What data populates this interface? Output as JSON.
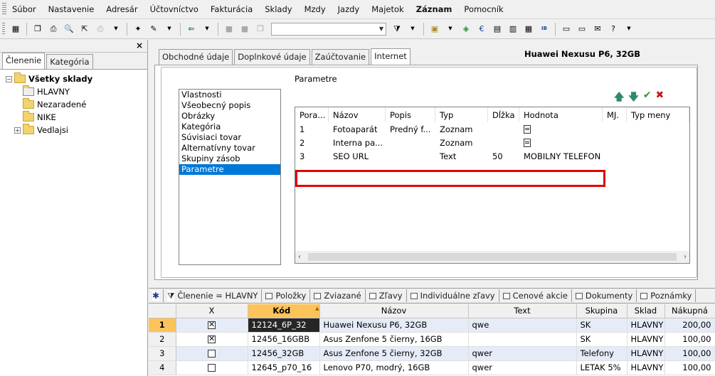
{
  "menubar": {
    "items": [
      "Súbor",
      "Nastavenie",
      "Adresár",
      "Účtovníctvo",
      "Fakturácia",
      "Sklady",
      "Mzdy",
      "Jazdy",
      "Majetok",
      "Záznam",
      "Pomocník"
    ]
  },
  "toolbar": {
    "combo_value": ""
  },
  "left_panel": {
    "tabs": [
      "Členenie",
      "Kategória"
    ],
    "tree": {
      "root": "Všetky sklady",
      "items": [
        "HLAVNY",
        "Nezaradené",
        "NIKE",
        "Vedlajsi"
      ]
    }
  },
  "detail": {
    "tabs": [
      "Obchodné údaje",
      "Doplnkové údaje",
      "Zaúčtovanie",
      "Internet"
    ],
    "product_title": "Huawei Nexusu P6, 32GB",
    "categories": [
      "Vlastnosti",
      "Všeobecný popis",
      "Obrázky",
      "Kategória",
      "Súvisiaci tovar",
      "Alternatívny tovar",
      "Skupiny zásob",
      "Parametre"
    ],
    "section_label": "Parametre",
    "grid": {
      "columns": [
        "Pora...",
        "Názov",
        "Popis",
        "Typ",
        "Dĺžka",
        "Hodnota",
        "MJ.",
        "Typ meny"
      ],
      "rows": [
        {
          "order": "1",
          "name": "Fotoaparát",
          "desc": "Predný f...",
          "type": "Zoznam",
          "length": "",
          "value": ""
        },
        {
          "order": "2",
          "name": "Interna pa...",
          "desc": "",
          "type": "Zoznam",
          "length": "",
          "value": ""
        },
        {
          "order": "3",
          "name": "SEO URL",
          "desc": "",
          "type": "Text",
          "length": "50",
          "value": "MOBILNY TELEFON"
        }
      ]
    }
  },
  "bottom_tabs": {
    "items": [
      "Členenie = HLAVNY",
      "Položky",
      "Zviazané",
      "Zľavy",
      "Individuálne zľavy",
      "Cenové akcie",
      "Dokumenty",
      "Poznámky"
    ]
  },
  "table": {
    "columns": [
      "",
      "X",
      "Kód",
      "Názov",
      "Text",
      "Skupina",
      "Sklad",
      "Nákupná"
    ],
    "rows": [
      {
        "num": "1",
        "checked": true,
        "kod": "12124_6P_32",
        "nazov": "Huawei Nexusu P6, 32GB",
        "text": "qwe",
        "skupina": "SK",
        "sklad": "HLAVNY",
        "nakupna": "200,00"
      },
      {
        "num": "2",
        "checked": true,
        "kod": "12456_16GBB",
        "nazov": "Asus Zenfone 5 čierny, 16GB",
        "text": "",
        "skupina": "SK",
        "sklad": "HLAVNY",
        "nakupna": "100,00"
      },
      {
        "num": "3",
        "checked": false,
        "kod": "12456_32GB",
        "nazov": "Asus Zenfone 5 čierny, 32GB",
        "text": "qwer",
        "skupina": "Telefony",
        "sklad": "HLAVNY",
        "nakupna": "100,00"
      },
      {
        "num": "4",
        "checked": false,
        "kod": "12645_p70_16",
        "nazov": "Lenovo P70, modrý, 16GB",
        "text": "qwer",
        "skupina": "LETAK 5%",
        "sklad": "HLAVNY",
        "nakupna": "100,00"
      }
    ]
  },
  "colors": {
    "selection_blue": "#0078d7",
    "highlight_red": "#e00000",
    "header_orange": "#fcc35a",
    "row_alt": "#e6ecf7"
  }
}
